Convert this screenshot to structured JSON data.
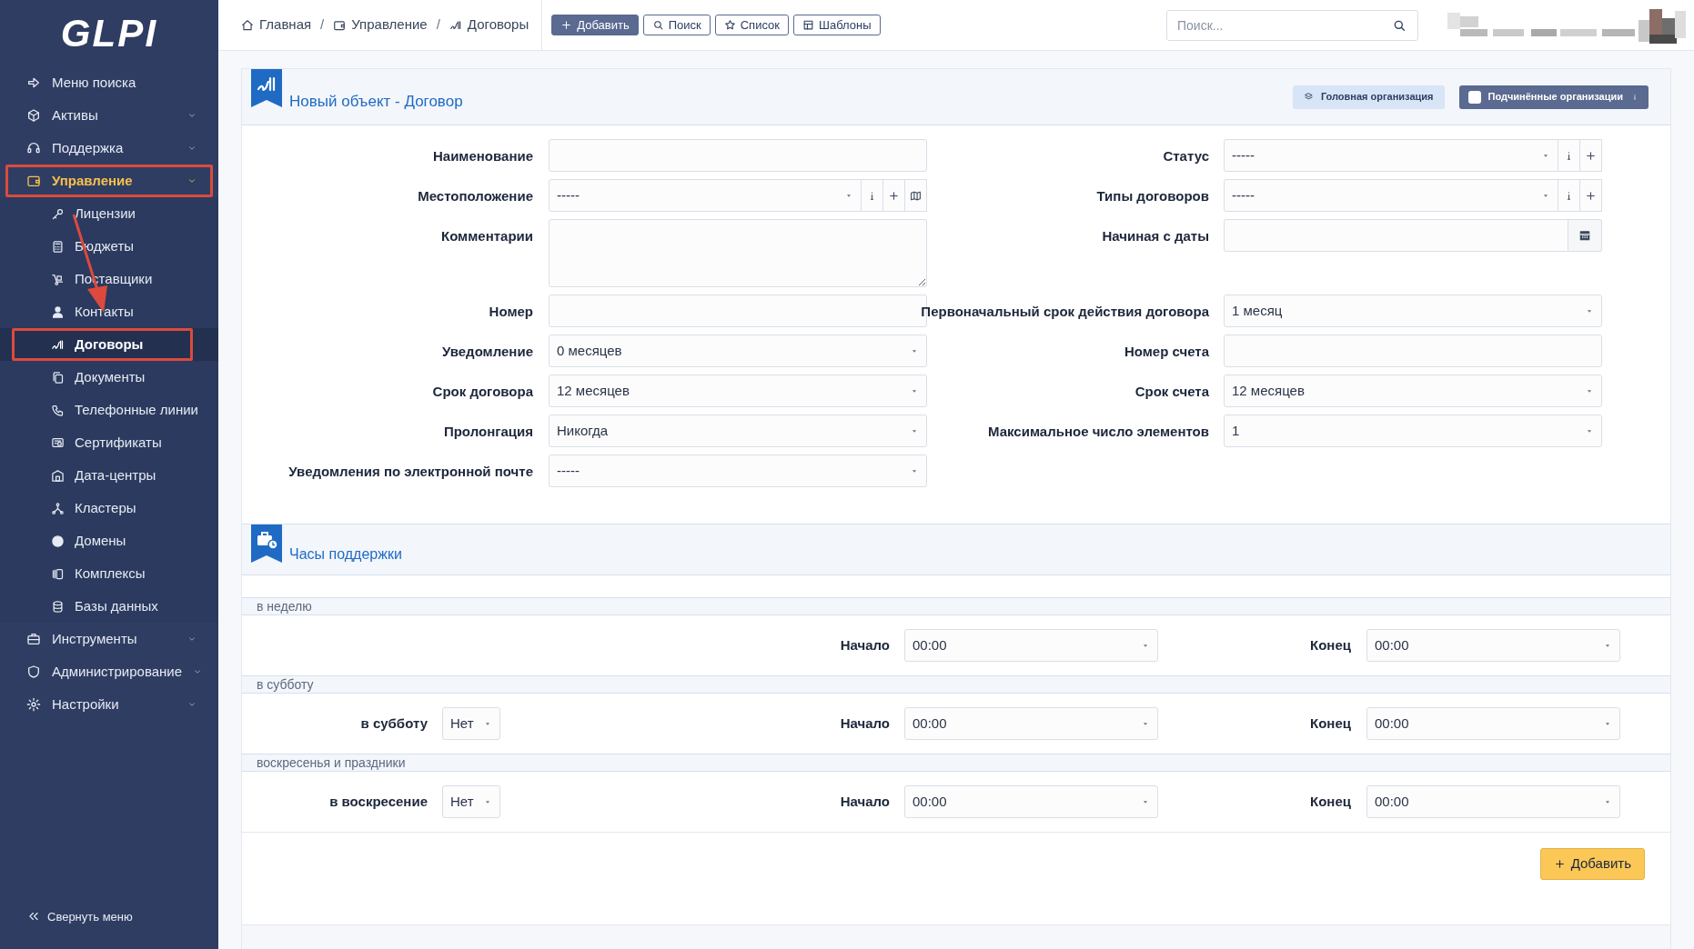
{
  "logo": {
    "text": "GLPI"
  },
  "sidebar": {
    "items": [
      {
        "label": "Меню поиска",
        "kind": "link",
        "selected": false,
        "highlighted": false
      },
      {
        "label": "Активы",
        "kind": "group",
        "expanded": false,
        "selected": false,
        "highlighted": false
      },
      {
        "label": "Поддержка",
        "kind": "group",
        "expanded": false,
        "selected": false,
        "highlighted": false
      },
      {
        "label": "Управление",
        "kind": "group",
        "expanded": true,
        "selected": true,
        "highlighted": true,
        "children": [
          {
            "label": "Лицензии",
            "selected": false,
            "highlighted": false
          },
          {
            "label": "Бюджеты",
            "selected": false,
            "highlighted": false
          },
          {
            "label": "Поставщики",
            "selected": false,
            "highlighted": false
          },
          {
            "label": "Контакты",
            "selected": false,
            "highlighted": false
          },
          {
            "label": "Договоры",
            "selected": true,
            "highlighted": true
          },
          {
            "label": "Документы",
            "selected": false,
            "highlighted": false
          },
          {
            "label": "Телефонные линии",
            "selected": false,
            "highlighted": false
          },
          {
            "label": "Сертификаты",
            "selected": false,
            "highlighted": false
          },
          {
            "label": "Дата-центры",
            "selected": false,
            "highlighted": false
          },
          {
            "label": "Кластеры",
            "selected": false,
            "highlighted": false
          },
          {
            "label": "Домены",
            "selected": false,
            "highlighted": false
          },
          {
            "label": "Комплексы",
            "selected": false,
            "highlighted": false
          },
          {
            "label": "Базы данных",
            "selected": false,
            "highlighted": false
          }
        ]
      },
      {
        "label": "Инструменты",
        "kind": "group",
        "expanded": false,
        "selected": false,
        "highlighted": false
      },
      {
        "label": "Администрирование",
        "kind": "group",
        "expanded": false,
        "selected": false,
        "highlighted": false
      },
      {
        "label": "Настройки",
        "kind": "group",
        "expanded": false,
        "selected": false,
        "highlighted": false
      }
    ],
    "collapse": "Свернуть меню"
  },
  "topbar": {
    "breadcrumbs": [
      "Главная",
      "Управление",
      "Договоры"
    ],
    "breadcrumb_separators": [
      "/",
      "/"
    ],
    "buttons": [
      {
        "label": "Добавить",
        "kind": "primary"
      },
      {
        "label": "Поиск",
        "kind": "search"
      },
      {
        "label": "Список",
        "kind": "star"
      },
      {
        "label": "Шаблоны",
        "kind": "templates"
      }
    ],
    "search": {
      "placeholder": "Поиск..."
    }
  },
  "form": {
    "title": "Новый объект - Договор",
    "entity": "Головная организация",
    "subentities": {
      "label": "Подчинённые организации",
      "checked": false
    },
    "rows": [
      {
        "left": {
          "label": "Наименование",
          "kind": "text"
        },
        "right": {
          "label": "Статус",
          "kind": "select",
          "value": "-----",
          "info_button": true,
          "add_button": true
        }
      },
      {
        "left": {
          "label": "Местоположение",
          "kind": "select",
          "value": "-----",
          "info_button": true,
          "add_button": true,
          "map_button": true
        },
        "right": {
          "label": "Типы договоров",
          "kind": "select",
          "value": "-----",
          "info_button": true,
          "add_button": true
        }
      },
      {
        "left": {
          "label": "Комментарии",
          "kind": "textarea"
        },
        "right": {
          "label": "Начиная с даты",
          "kind": "date"
        }
      },
      {
        "left": {
          "label": "Номер",
          "kind": "text"
        },
        "right": {
          "label": "Первоначальный срок действия договора",
          "kind": "select",
          "value": "1 месяц"
        }
      },
      {
        "left": {
          "label": "Уведомление",
          "kind": "select",
          "value": "0 месяцев"
        },
        "right": {
          "label": "Номер счета",
          "kind": "text"
        }
      },
      {
        "left": {
          "label": "Срок договора",
          "kind": "select",
          "value": "12 месяцев"
        },
        "right": {
          "label": "Срок счета",
          "kind": "select",
          "value": "12 месяцев"
        }
      },
      {
        "left": {
          "label": "Пролонгация",
          "kind": "select",
          "value": "Никогда"
        },
        "right": {
          "label": "Максимальное число элементов",
          "kind": "select",
          "value": "1"
        }
      },
      {
        "left": {
          "label": "Уведомления по электронной почте",
          "kind": "select",
          "value": "-----"
        }
      }
    ]
  },
  "support_hours": {
    "title": "Часы поддержки",
    "groups": [
      {
        "title": "в неделю",
        "start_label": "Начало",
        "start": "00:00",
        "end_label": "Конец",
        "end": "00:00"
      },
      {
        "title": "в субботу",
        "day_label": "в субботу",
        "day_value": "Нет",
        "start_label": "Начало",
        "start": "00:00",
        "end_label": "Конец",
        "end": "00:00"
      },
      {
        "title": "воскресенья и праздники",
        "day_label": "в воскресение",
        "day_value": "Нет",
        "start_label": "Начало",
        "start": "00:00",
        "end_label": "Конец",
        "end": "00:00"
      }
    ],
    "add_button": "Добавить"
  }
}
